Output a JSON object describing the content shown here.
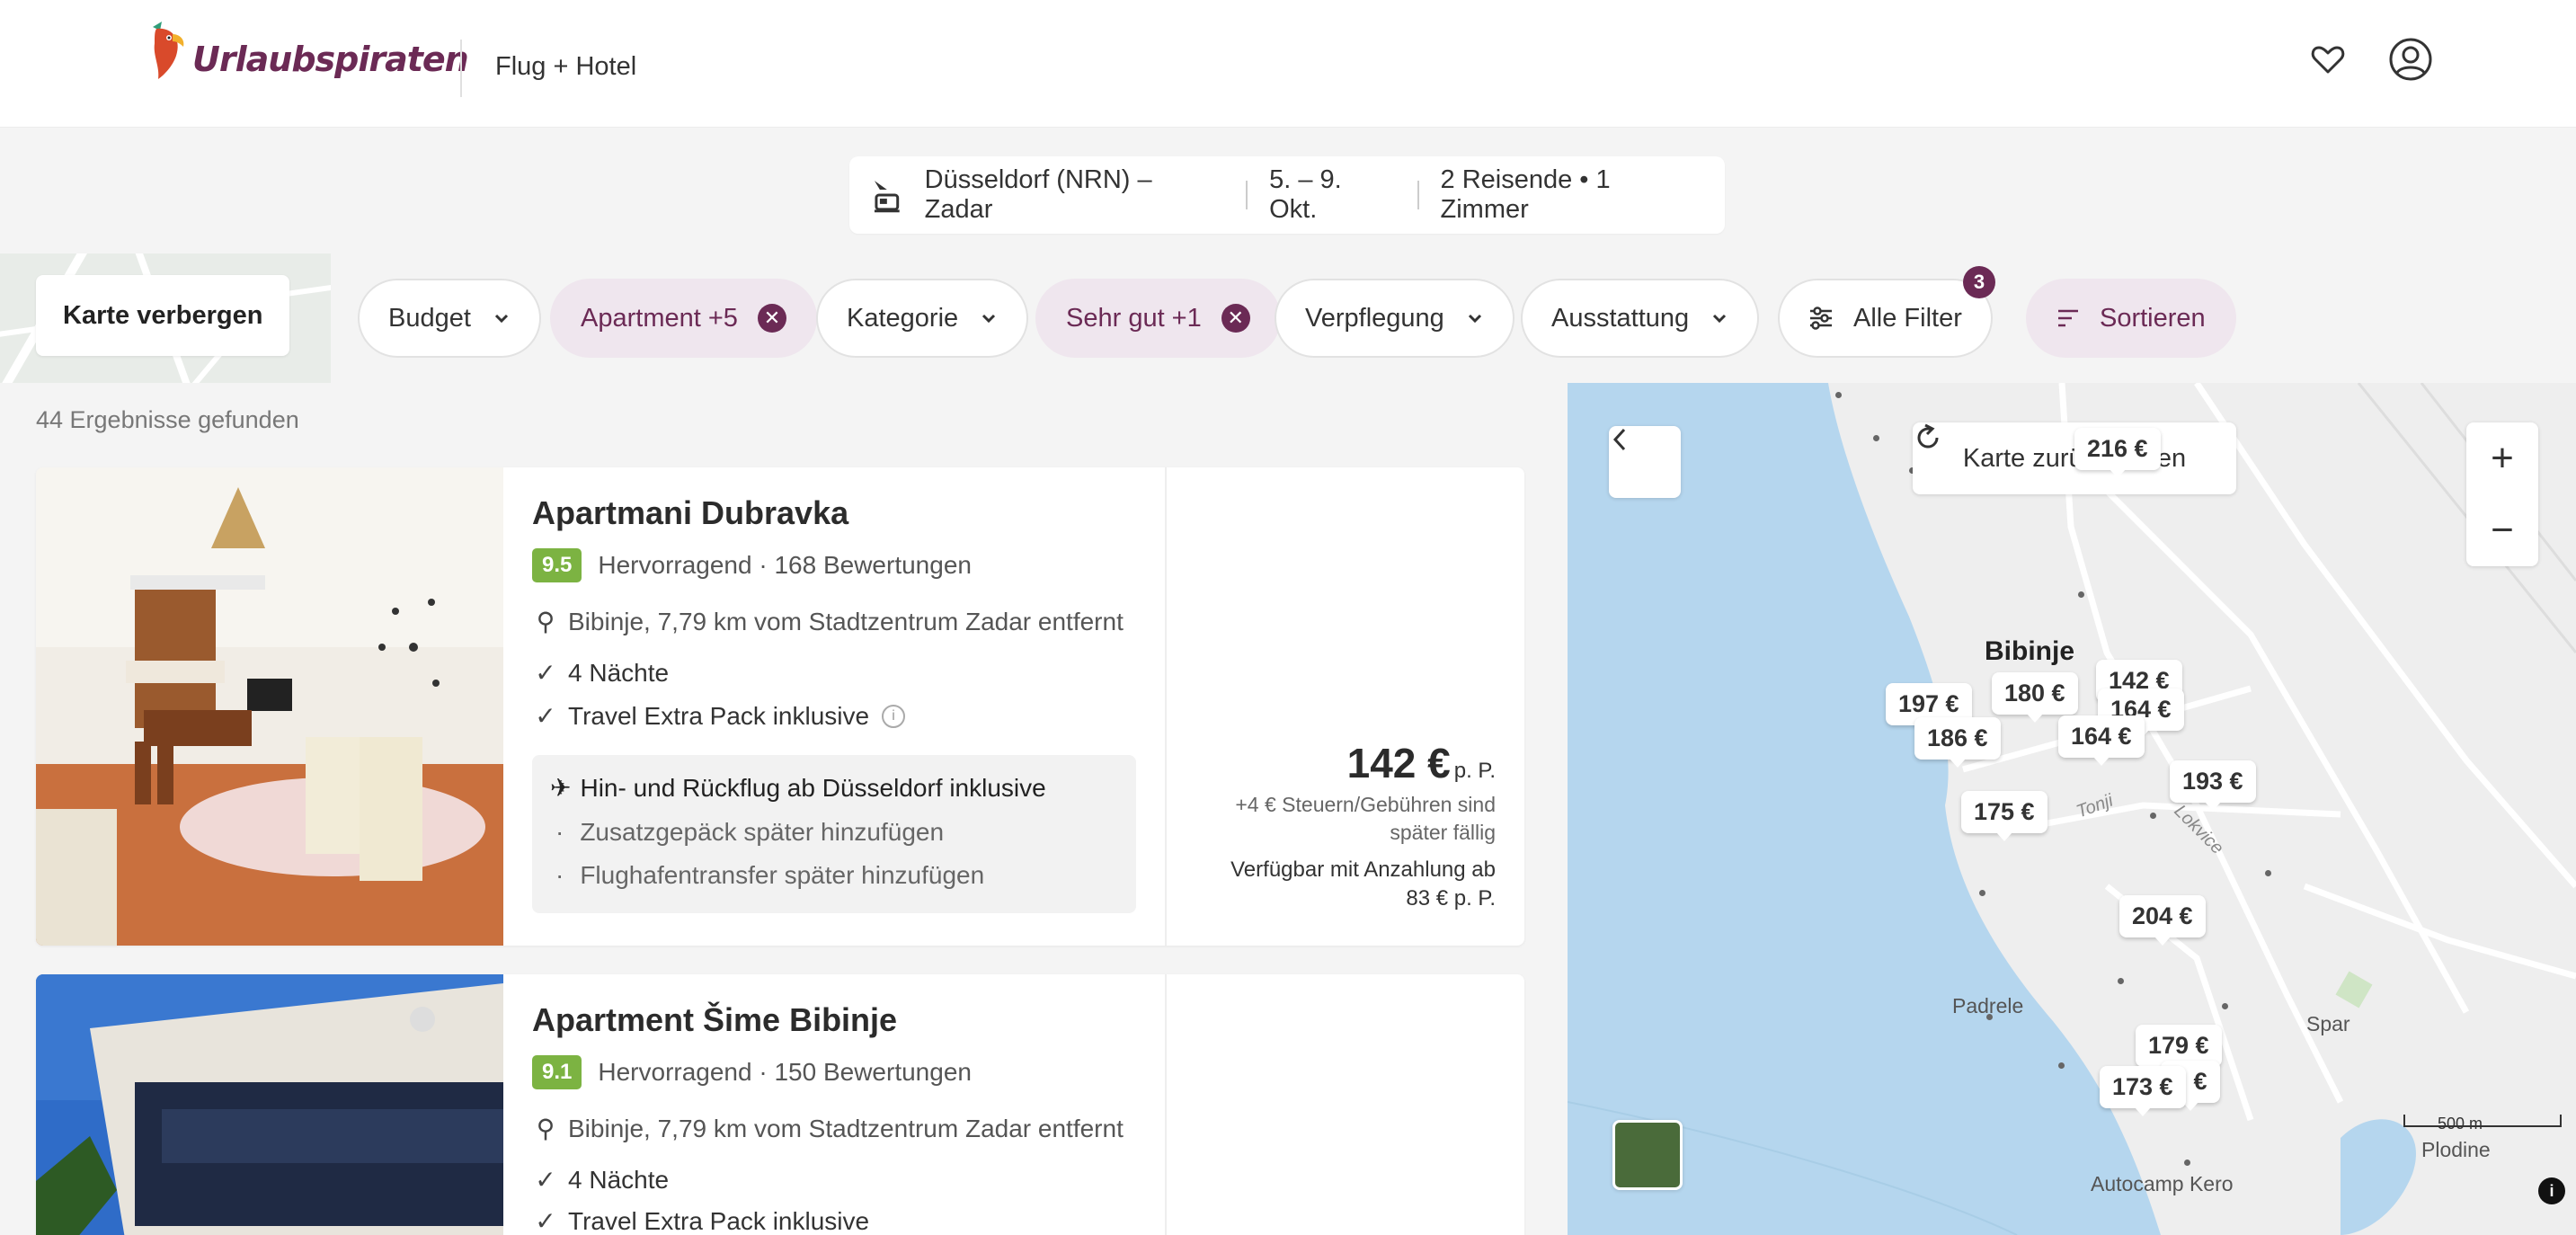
{
  "header": {
    "brand": "Urlaubspiraten",
    "product": "Flug + Hotel",
    "icons": [
      "heart-icon",
      "user-icon"
    ]
  },
  "search": {
    "route": "Düsseldorf (NRN) – Zadar",
    "dates": "5. – 9. Okt.",
    "travellers": "2 Reisende • 1 Zimmer"
  },
  "filters": {
    "hide_map": "Karte verbergen",
    "chips": [
      {
        "label": "Budget",
        "active": false
      },
      {
        "label": "Apartment +5",
        "active": true
      },
      {
        "label": "Kategorie",
        "active": false
      },
      {
        "label": "Sehr gut +1",
        "active": true
      },
      {
        "label": "Verpflegung",
        "active": false
      },
      {
        "label": "Ausstattung",
        "active": false
      }
    ],
    "all_filters": "Alle Filter",
    "all_filters_count": "3",
    "sort": "Sortieren"
  },
  "results": {
    "count_text": "44 Ergebnisse gefunden",
    "items": [
      {
        "name": "Apartmani Dubravka",
        "score": "9.5",
        "rating_text": "Hervorragend · 168 Bewertungen",
        "location": "Bibinje, 7,79 km vom Stadtzentrum Zadar entfernt",
        "nights": "4 Nächte",
        "extra": "Travel Extra Pack inklusive",
        "flight": "Hin- und Rückflug ab Düsseldorf inklusive",
        "addon1": "Zusatzgepäck später hinzufügen",
        "addon2": "Flughafentransfer später hinzufügen",
        "price": "142 €",
        "price_unit": "p. P.",
        "tax_note": "+4 € Steuern/Gebühren sind später fällig",
        "deposit_note": "Verfügbar mit Anzahlung ab 83 € p. P."
      },
      {
        "name": "Apartment Šime Bibinje",
        "score": "9.1",
        "rating_text": "Hervorragend · 150 Bewertungen",
        "location": "Bibinje, 7,79 km vom Stadtzentrum Zadar entfernt",
        "nights": "4 Nächte",
        "extra": "Travel Extra Pack inklusive"
      }
    ]
  },
  "map": {
    "reset": "Karte zurücksetzen",
    "labels": {
      "bibinje": "Bibinje",
      "padrele": "Padrele",
      "spar": "Spar",
      "autocamp": "Autocamp Kero",
      "plodine": "Plodine",
      "tonji": "Tonji",
      "lokvice": "Lokvice",
      "scale": "500 m"
    },
    "pins": [
      "142 €",
      "180 €",
      "164 €",
      "197 €",
      "186 €",
      "164 €",
      "193 €",
      "175 €",
      "204 €",
      "179 €",
      "173 €",
      "3 €",
      "216 €"
    ],
    "colors": {
      "sea": "#b5d6ee",
      "land": "#eeeeee",
      "accent": "#6b2a55",
      "rating": "#7cb342"
    }
  }
}
